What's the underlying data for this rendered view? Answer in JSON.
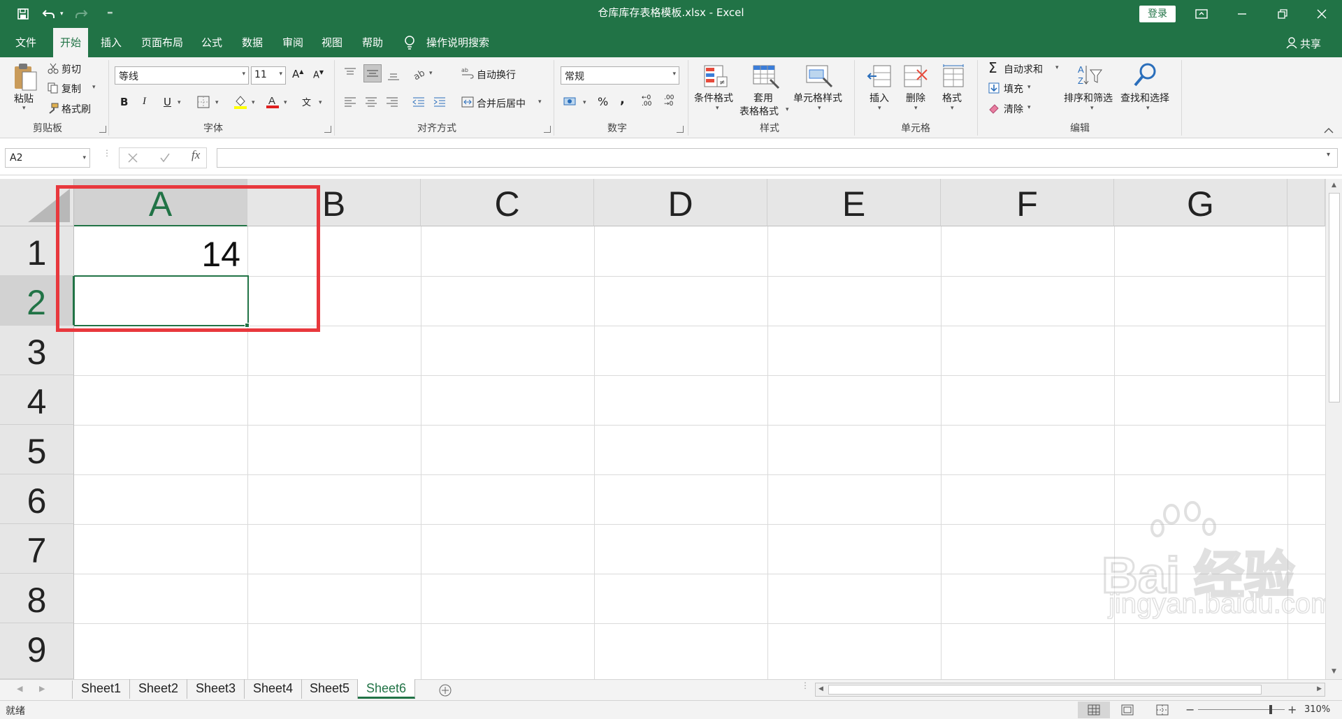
{
  "titlebar": {
    "title": "仓库库存表格模板.xlsx  -  Excel",
    "login": "登录"
  },
  "tabs": [
    {
      "label": "文件"
    },
    {
      "label": "开始"
    },
    {
      "label": "插入"
    },
    {
      "label": "页面布局"
    },
    {
      "label": "公式"
    },
    {
      "label": "数据"
    },
    {
      "label": "审阅"
    },
    {
      "label": "视图"
    },
    {
      "label": "帮助"
    },
    {
      "label": "操作说明搜索"
    }
  ],
  "share": "共享",
  "ribbon": {
    "clipboard": {
      "paste": "粘贴",
      "cut": "剪切",
      "copy": "复制",
      "format_painter": "格式刷",
      "label": "剪贴板"
    },
    "font": {
      "name": "等线",
      "size": "11",
      "bold": "B",
      "italic": "I",
      "underline": "U",
      "label": "字体"
    },
    "align": {
      "wrap": "自动换行",
      "merge": "合并后居中",
      "label": "对齐方式"
    },
    "number": {
      "format": "常规",
      "percent": "%",
      "comma": ",",
      "label": "数字"
    },
    "styles": {
      "cond": "条件格式",
      "table1": "套用",
      "table2": "表格格式",
      "cell_style": "单元格样式",
      "label": "样式"
    },
    "cells": {
      "insert": "插入",
      "delete": "删除",
      "format": "格式",
      "label": "单元格"
    },
    "editing": {
      "autosum": "自动求和",
      "fill": "填充",
      "clear": "清除",
      "sort": "排序和筛选",
      "find": "查找和选择",
      "label": "编辑"
    }
  },
  "formula_bar": {
    "name_box": "A2",
    "fx": "fx",
    "value": ""
  },
  "columns": [
    "A",
    "B",
    "C",
    "D",
    "E",
    "F",
    "G"
  ],
  "rows": [
    "1",
    "2",
    "3",
    "4",
    "5",
    "6",
    "7",
    "8",
    "9"
  ],
  "cells": {
    "A1": "14"
  },
  "active_cell": "A2",
  "sheets": [
    {
      "name": "Sheet1"
    },
    {
      "name": "Sheet2"
    },
    {
      "name": "Sheet3"
    },
    {
      "name": "Sheet4"
    },
    {
      "name": "Sheet5"
    },
    {
      "name": "Sheet6"
    }
  ],
  "active_sheet": "Sheet6",
  "status": {
    "ready": "就绪",
    "zoom": "310%"
  },
  "watermark": {
    "logo": "Bai 经验",
    "url": "jingyan.baidu.com"
  },
  "colors": {
    "excel_green": "#217346",
    "highlight_red": "#e8383d"
  }
}
